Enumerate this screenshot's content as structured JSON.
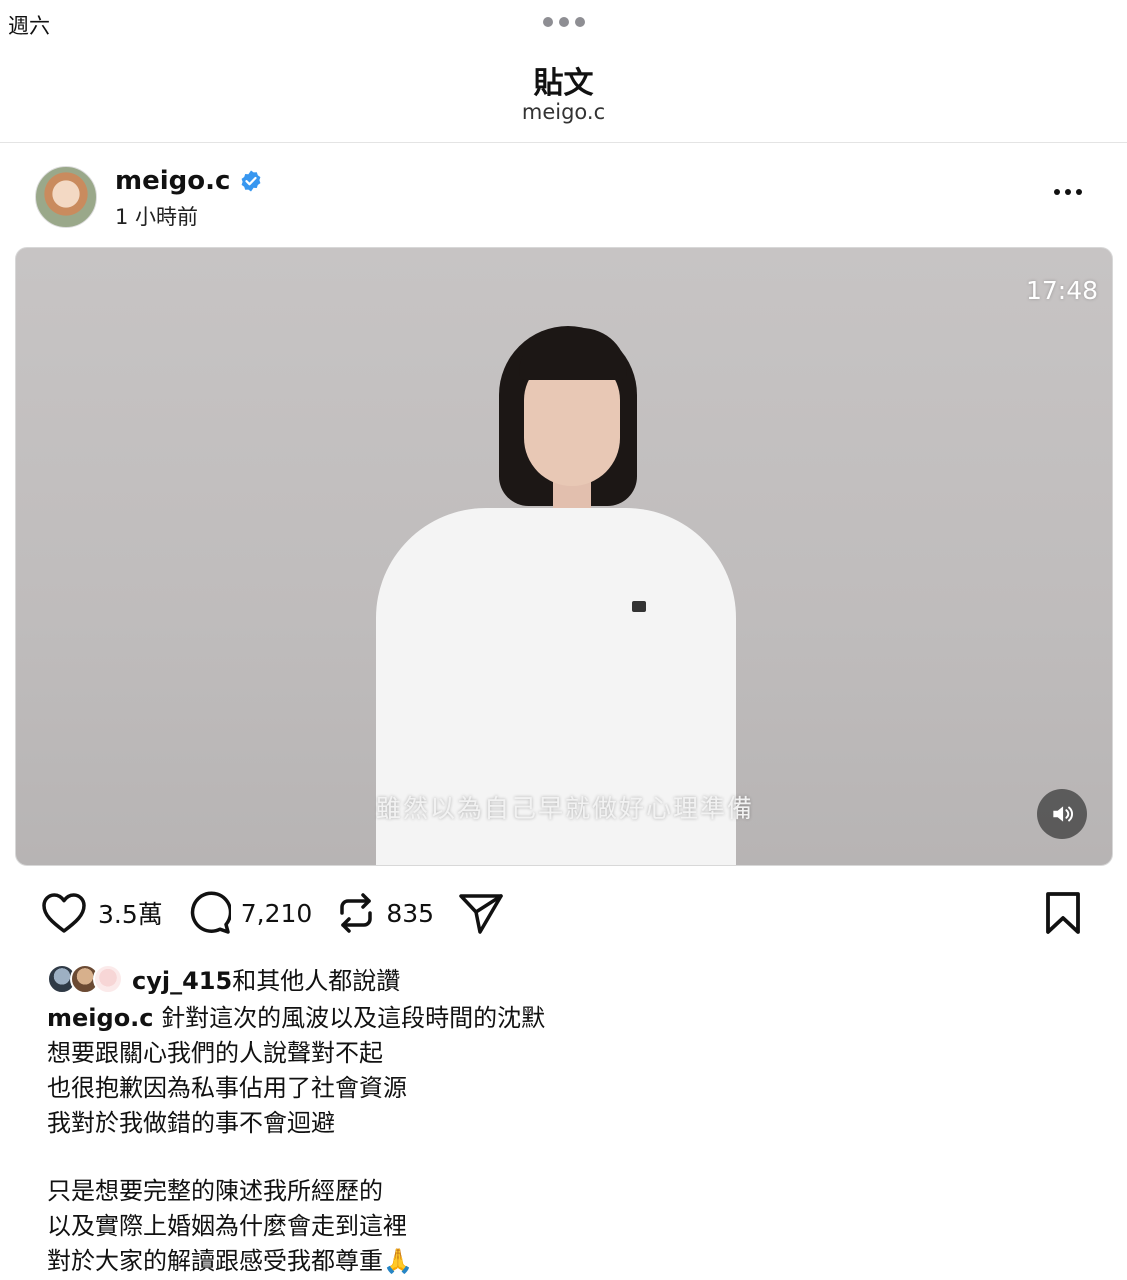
{
  "status_bar": {
    "day": "週六"
  },
  "nav": {
    "title": "貼文",
    "subtitle": "meigo.c"
  },
  "post": {
    "username": "meigo.c",
    "verified": true,
    "time": "1 小時前",
    "video": {
      "duration": "17:48",
      "subtitle": "雖然以為自己早就做好心理準備"
    },
    "stats": {
      "likes": "3.5萬",
      "comments": "7,210",
      "reposts": "835"
    },
    "liked_by": {
      "username": "cyj_415",
      "suffix": "和其他人都說讚"
    },
    "caption": {
      "user": "meigo.c",
      "lines": [
        "針對這次的風波以及這段時間的沈默",
        "想要跟關心我們的人說聲對不起",
        "也很抱歉因為私事佔用了社會資源",
        "我對於我做錯的事不會迴避",
        "只是想要完整的陳述我所經歷的",
        "以及實際上婚姻為什麼會走到這裡",
        "對於大家的解讀跟感受我都尊重🙏"
      ]
    }
  },
  "icons": {
    "verified": "verified-badge-icon",
    "like": "heart-icon",
    "comment": "comment-bubble-icon",
    "repost": "repost-icon",
    "share": "send-icon",
    "bookmark": "bookmark-icon",
    "mute": "speaker-icon",
    "more": "more-options-icon"
  },
  "colors": {
    "verified": "#3897f0",
    "text": "#111111"
  }
}
